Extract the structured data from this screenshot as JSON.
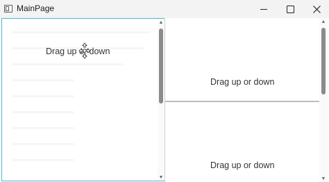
{
  "window": {
    "title": "MainPage"
  },
  "panes": {
    "left": {
      "label": "Drag up or down"
    },
    "right_top": {
      "label": "Drag up or down"
    },
    "right_bottom": {
      "label": "Drag up or down"
    }
  },
  "icons": {
    "app": "app-window-icon",
    "minimize": "minimize-icon",
    "maximize": "maximize-icon",
    "close": "close-icon",
    "cursor": "move-cursor-icon"
  },
  "colors": {
    "focus_border": "#4cb6d8",
    "scrollbar_thumb": "#8b8b8b"
  }
}
